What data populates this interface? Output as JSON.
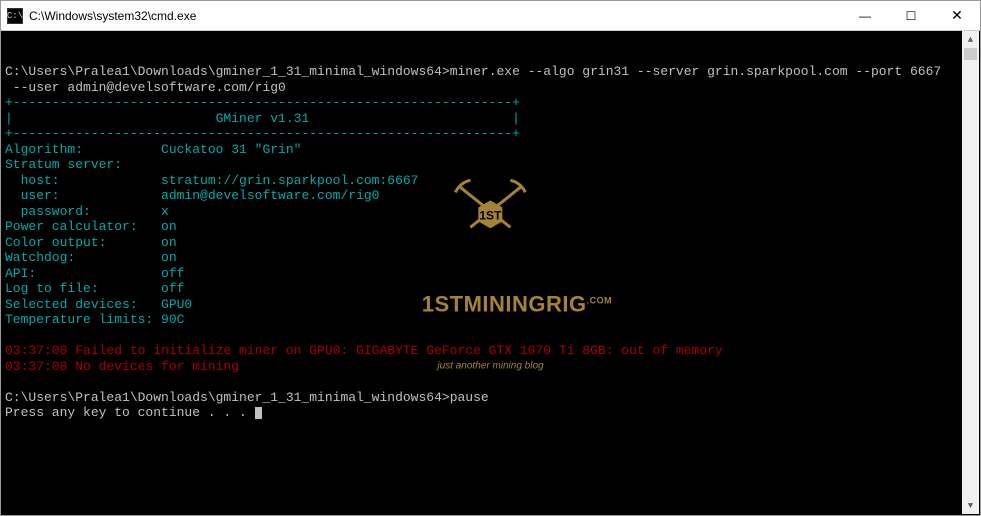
{
  "window": {
    "title": "C:\\Windows\\system32\\cmd.exe",
    "icon_glyph": "C:\\"
  },
  "controls": {
    "minimize": "—",
    "maximize": "☐",
    "close": "✕"
  },
  "terminal": {
    "prompt_path": "C:\\Users\\Pralea1\\Downloads\\gminer_1_31_minimal_windows64>",
    "cmd_line1": "miner.exe --algo grin31 --server grin.sparkpool.com --port 6667",
    "cmd_line2": " --user admin@develsoftware.com/rig0",
    "box_top": "+----------------------------------------------------------------+",
    "box_title": "|                          GMiner v1.31                          |",
    "box_bot": "+----------------------------------------------------------------+",
    "info": {
      "algorithm_k": "Algorithm:          ",
      "algorithm_v": "Cuckatoo 31 \"Grin\"",
      "stratum_k": "Stratum server:",
      "host_k": "  host:             ",
      "host_v": "stratum://grin.sparkpool.com:6667",
      "user_k": "  user:             ",
      "user_v": "admin@develsoftware.com/rig0",
      "pass_k": "  password:         ",
      "pass_v": "x",
      "power_k": "Power calculator:   ",
      "power_v": "on",
      "color_k": "Color output:       ",
      "color_v": "on",
      "watch_k": "Watchdog:           ",
      "watch_v": "on",
      "api_k": "API:                ",
      "api_v": "off",
      "log_k": "Log to file:        ",
      "log_v": "off",
      "dev_k": "Selected devices:   ",
      "dev_v": "GPU0",
      "temp_k": "Temperature limits: ",
      "temp_v": "90C"
    },
    "errors": {
      "e1": "03:37:08 Failed to initialize miner on GPU0: GIGABYTE GeForce GTX 1070 Ti 8GB: out of memory",
      "e2": "03:37:08 No devices for mining"
    },
    "pause_cmd": "pause",
    "press_key": "Press any key to continue . . . "
  },
  "watermark": {
    "title": "1STMININGRIG",
    "sub": "just another mining blog",
    "dotcom": ".COM"
  }
}
